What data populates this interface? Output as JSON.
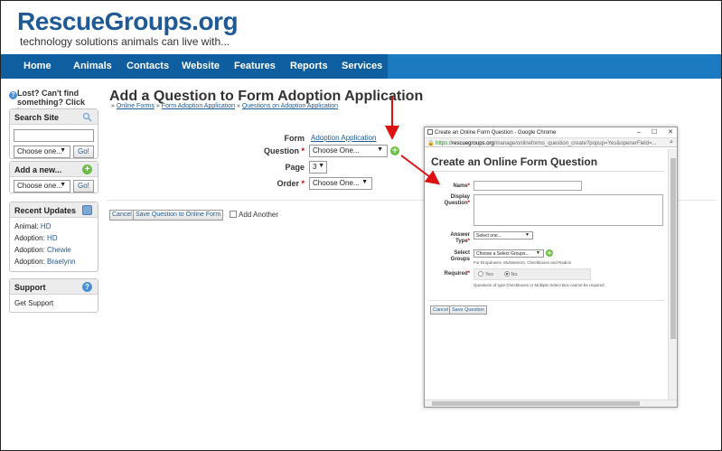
{
  "logo": {
    "main": "RescueGroups.org",
    "tagline": "technology solutions animals can live with..."
  },
  "nav": {
    "items": [
      "Home",
      "Animals",
      "Contacts",
      "Website",
      "Features",
      "Reports",
      "Services"
    ]
  },
  "colors": {
    "nav_bg": "#1c7bc0",
    "nav_dark": "#0f5e9f",
    "brand": "#1f5a97",
    "required": "#cc0000",
    "add_icon": "#6cbf45",
    "arrow": "#dd1111"
  },
  "sidebar": {
    "lost": "Lost? Can't find something? Click here.",
    "search_site": {
      "title": "Search Site",
      "select": "Choose one...",
      "go": "Go!"
    },
    "add_new": {
      "title": "Add a new...",
      "select": "Choose one...",
      "go": "Go!"
    },
    "recent_updates": {
      "title": "Recent Updates",
      "items": [
        {
          "prefix": "Animal:",
          "link": "HD"
        },
        {
          "prefix": "Adoption:",
          "link": "HD"
        },
        {
          "prefix": "Adoption:",
          "link": "Chewie"
        },
        {
          "prefix": "Adoption:",
          "link": "Braelynn"
        }
      ]
    },
    "support": {
      "title": "Support",
      "item": "Get Support"
    }
  },
  "main": {
    "title": "Add a Question to Form Adoption Application",
    "breadcrumb": [
      "Online Forms",
      "Form Adoption Application",
      "Questions on Adoption Application"
    ],
    "breadcrumb_sep": "»",
    "form_label": "Form",
    "form_value": "Adoption Application",
    "question_label": "Question",
    "question_select": "Choose One...",
    "page_label": "Page",
    "page_value": "3",
    "order_label": "Order",
    "order_select": "Choose One...",
    "cancel": "Cancel",
    "save": "Save Question to Online Form",
    "add_another": "Add Another"
  },
  "popup": {
    "window_title": "Create an Online Form Question - Google Chrome",
    "url_prefix": "https://",
    "url_host": "rescuegroups.org",
    "url_path": "/manage/onlineforms_question_create?popup=Yes&openerField=...",
    "heading": "Create an Online Form Question",
    "name_label": "Name",
    "display_label": "Display",
    "display_label2": "Question",
    "answer_label": "Answer",
    "answer_label2": "Type",
    "answer_select": "Select one...",
    "select_label": "Select",
    "groups_label": "Groups",
    "groups_select": "Choose a Select Groups...",
    "groups_hint": "For Dropdowns, Multiselects, Checkboxes and Radios",
    "required_label": "Required",
    "yes": "Yes",
    "no": "No",
    "required_hint": "Questions of type Checkboxes or Multiple Select Box cannot be required",
    "cancel": "Cancel",
    "save": "Save Question"
  }
}
